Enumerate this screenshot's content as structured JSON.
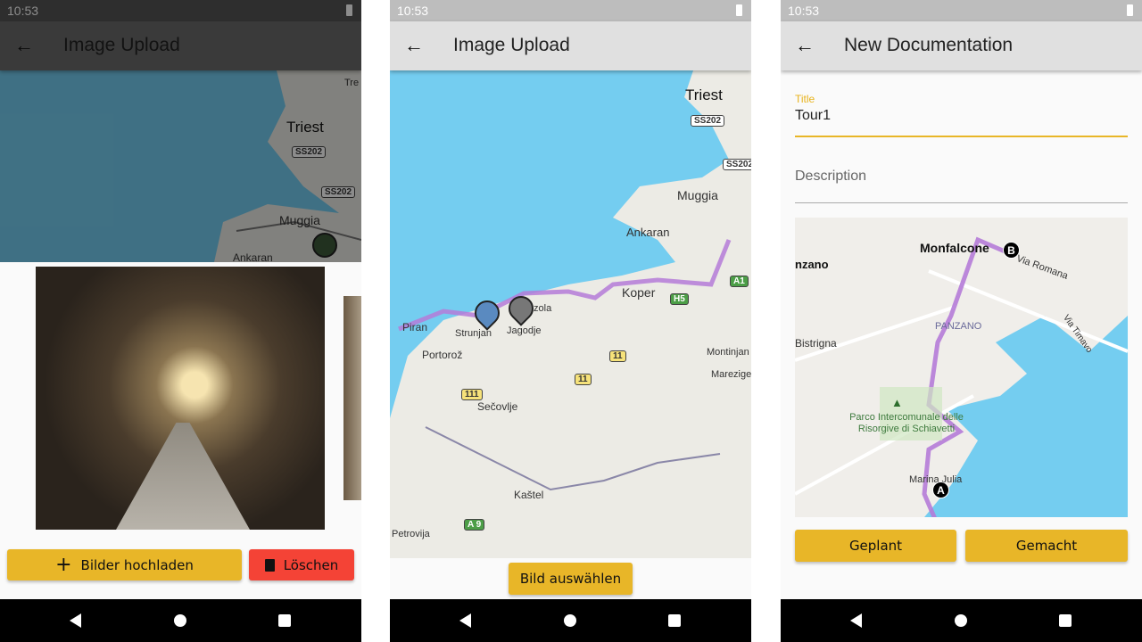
{
  "status_time": "10:53",
  "screen1": {
    "title": "Image Upload",
    "map_labels": [
      "Triest",
      "Muggia",
      "Ankaran",
      "Tre"
    ],
    "road_shields": [
      "SS202",
      "SS202"
    ],
    "upload_button": "Bilder hochladen",
    "delete_button": "Löschen"
  },
  "screen2": {
    "title": "Image Upload",
    "map_labels": [
      "Triest",
      "Muggia",
      "Ankaran",
      "Koper",
      "Piran",
      "Portorož",
      "Strunjan",
      "Jagodje",
      "Izola",
      "Sečovlje",
      "Kaštel",
      "Montinjan",
      "Marezige",
      "Petrovija"
    ],
    "road_shields": [
      "SS202",
      "SS202",
      "A1",
      "H5",
      "11",
      "11",
      "111",
      "A 9"
    ],
    "select_button": "Bild auswählen"
  },
  "screen3": {
    "title": "New Documentation",
    "title_field_label": "Title",
    "title_field_value": "Tour1",
    "description_placeholder": "Description",
    "map_labels": [
      "Monfalcone",
      "Via Romana",
      "nzano",
      "PANZANO",
      "Bistrigna",
      "Via Timavo",
      "Parco Intercomunale delle Risorgive di Schiavetti",
      "Marina Julia"
    ],
    "marker_a": "A",
    "marker_b": "B",
    "planned_button": "Geplant",
    "done_button": "Gemacht"
  },
  "colors": {
    "accent": "#e8b628",
    "delete": "#f44336",
    "route": "#b57bd8",
    "water": "#74cdf0",
    "land": "#f0eeea"
  }
}
